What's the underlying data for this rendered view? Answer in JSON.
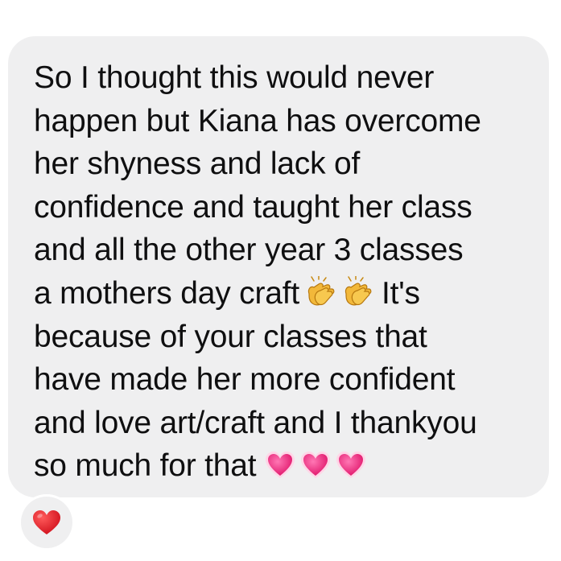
{
  "message": {
    "line1": "So I thought this would never",
    "line2": "happen but Kiana has overcome",
    "line3": "her shyness and lack of",
    "line4": "confidence and taught her class",
    "line5": "and all the other year 3 classes",
    "line6_before": "a mothers day craft",
    "line6_after": "It's",
    "line7": "because of your classes that",
    "line8": "have made her more confident",
    "line9": "and love art/craft and I thankyou",
    "line10": "so much for that",
    "inline_emojis": [
      "clapping-hands-icon",
      "clapping-hands-icon",
      "pink-heart-icon",
      "pink-heart-icon",
      "pink-heart-icon"
    ]
  },
  "reaction": {
    "icon": "red-heart-icon",
    "color": "#e5202e"
  },
  "colors": {
    "bubble": "#efeff0",
    "text": "#0f0f10",
    "pink_heart": "#f0307e",
    "clap": "#f2b83a"
  }
}
